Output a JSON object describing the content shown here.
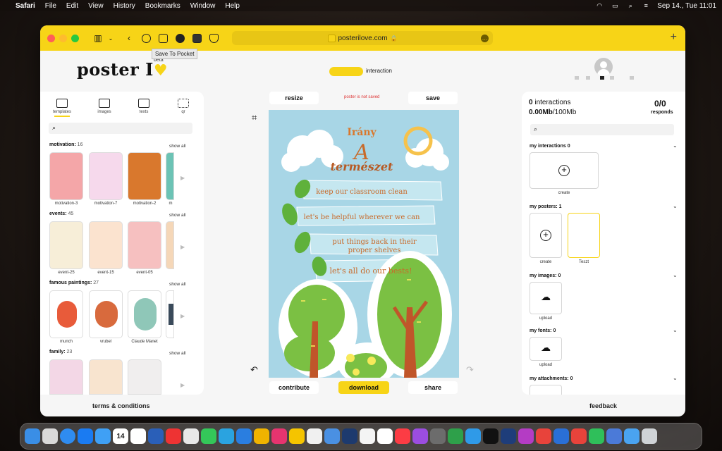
{
  "menubar": {
    "apple": "",
    "app": "Safari",
    "items": [
      "File",
      "Edit",
      "View",
      "History",
      "Bookmarks",
      "Window",
      "Help"
    ],
    "datetime": "Sep 14., Tue  11:01"
  },
  "browser": {
    "url": "posterilove.com",
    "tooltip": "Save To Pocket",
    "new_tab": "+"
  },
  "header": {
    "logo": "poster I",
    "logo_heart": "♥",
    "beta": "beta",
    "interaction_label": "interaction"
  },
  "left_panel": {
    "tabs": [
      {
        "label": "templates",
        "icon": "templates-icon"
      },
      {
        "label": "images",
        "icon": "image-icon"
      },
      {
        "label": "texts",
        "icon": "text-icon"
      },
      {
        "label": "qr",
        "icon": "qr-icon"
      }
    ],
    "categories": [
      {
        "name": "motivation",
        "count": "16",
        "show_all": "show all",
        "items": [
          {
            "label": "motivation-3",
            "color": "#f4a6a8"
          },
          {
            "label": "motivation-7",
            "color": "#f6d9ec"
          },
          {
            "label": "motivation-2",
            "color": "#d9782d"
          },
          {
            "label": "m",
            "color": "#6cc3b5"
          }
        ]
      },
      {
        "name": "events",
        "count": "45",
        "show_all": "show all",
        "items": [
          {
            "label": "event-25",
            "color": "#f7eed8"
          },
          {
            "label": "event-15",
            "color": "#fbe3cf"
          },
          {
            "label": "event-05",
            "color": "#f6c0c0"
          },
          {
            "label": "",
            "color": "#f5d7b8"
          }
        ]
      },
      {
        "name": "famous paintings",
        "count": "27",
        "show_all": "show all",
        "items": [
          {
            "label": "munch",
            "color": "#e85b3a"
          },
          {
            "label": "vrubel",
            "color": "#d86a3d"
          },
          {
            "label": "Claude Manet",
            "color": "#8fc7b8"
          },
          {
            "label": "",
            "color": "#3a4a5a"
          }
        ]
      },
      {
        "name": "family",
        "count": "23",
        "show_all": "show all",
        "items": [
          {
            "label": "",
            "color": "#f3d7e6"
          },
          {
            "label": "",
            "color": "#f8e4cf"
          },
          {
            "label": "",
            "color": "#f0eeee"
          },
          {
            "label": "",
            "color": "#eee"
          }
        ]
      }
    ],
    "footer": "terms & conditions"
  },
  "editor": {
    "resize": "resize",
    "status": "poster is not saved",
    "save": "save",
    "contribute": "contribute",
    "download": "download",
    "share": "share",
    "poster": {
      "title_small": "Irány",
      "title_big": "A",
      "title_word": "természet",
      "lines": [
        "keep our classroom clean",
        "let's be helpful  wherever we can",
        "put things back in their",
        "proper shelves",
        "let's all do our bests!"
      ]
    }
  },
  "right_panel": {
    "interactions_count": "0",
    "interactions_label": "interactions",
    "storage_used": "0.00Mb",
    "storage_total": "/100Mb",
    "responds_count": "0/0",
    "responds_label": "responds",
    "sections": [
      {
        "title": "my interactions",
        "count": "0"
      },
      {
        "title": "my posters:",
        "count": "1"
      },
      {
        "title": "my images:",
        "count": "0"
      },
      {
        "title": "my fonts:",
        "count": "0"
      },
      {
        "title": "my attachments:",
        "count": "0"
      }
    ],
    "create_label": "create",
    "poster_name": "Teszt",
    "upload_label": "upload",
    "feedback": "feedback"
  },
  "colors": {
    "brand_yellow": "#f7d417",
    "poster_sky": "#a8d6e6",
    "poster_text": "#c86a2a",
    "status_red": "#d33333"
  },
  "dock_apps": [
    "finder-icon",
    "launchpad-icon",
    "safari-icon",
    "app-store-icon",
    "mail-icon",
    "calendar-icon",
    "reminders-icon",
    "photos-icon",
    "notes-icon",
    "messages-icon",
    "telegram-icon",
    "maps-icon",
    "photos2-icon",
    "music-icon",
    "podcasts-icon",
    "settings-icon",
    "terminal-icon",
    "trash-icon"
  ],
  "calendar_day": "14"
}
